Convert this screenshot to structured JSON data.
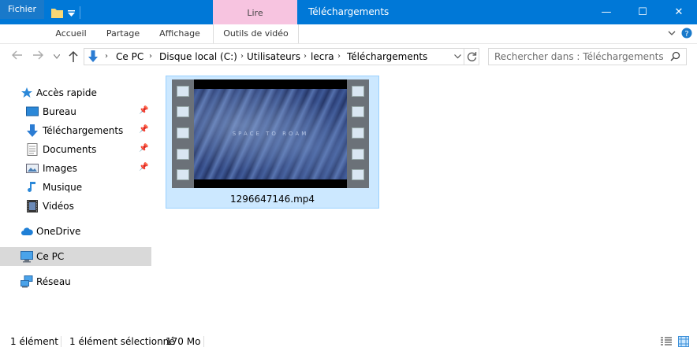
{
  "window": {
    "title": "Téléchargements",
    "context_group_label": "Lire",
    "accent_color": "#0078d7",
    "context_color": "#f7c4e0",
    "minimize_glyph": "—",
    "maximize_glyph": "☐",
    "close_glyph": "✕"
  },
  "ribbon": {
    "tabs": [
      "Fichier",
      "Accueil",
      "Partage",
      "Affichage",
      "Outils de vidéo"
    ]
  },
  "address": {
    "crumbs": [
      "Ce PC",
      "Disque local (C:)",
      "Utilisateurs",
      "lecra",
      "Téléchargements"
    ],
    "search_placeholder": "Rechercher dans : Téléchargements"
  },
  "nav": {
    "quick_access": "Accès rapide",
    "items": [
      {
        "label": "Bureau",
        "icon": "desktop-icon",
        "pinned": true
      },
      {
        "label": "Téléchargements",
        "icon": "download-icon",
        "pinned": true
      },
      {
        "label": "Documents",
        "icon": "document-icon",
        "pinned": true
      },
      {
        "label": "Images",
        "icon": "pictures-icon",
        "pinned": true
      },
      {
        "label": "Musique",
        "icon": "music-icon",
        "pinned": false
      },
      {
        "label": "Vidéos",
        "icon": "videos-icon",
        "pinned": false
      }
    ],
    "onedrive": "OneDrive",
    "this_pc": "Ce PC",
    "network": "Réseau"
  },
  "files": [
    {
      "name": "1296647146.mp4",
      "thumbnail_caption": "SPACE TO ROAM",
      "selected": true
    }
  ],
  "status": {
    "count": "1 élément",
    "selection": "1 élément sélectionné",
    "size": "170 Mo"
  }
}
